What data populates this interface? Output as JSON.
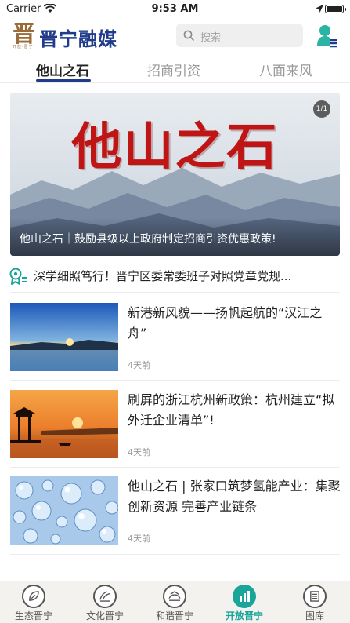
{
  "status_bar": {
    "carrier": "Carrier",
    "time": "9:53 AM"
  },
  "header": {
    "logo_glyph": "晋",
    "logo_sub": "开放·晋宁",
    "app_title": "晋宁融媒",
    "search_placeholder": "搜索"
  },
  "tabs": [
    {
      "label": "他山之石",
      "active": true
    },
    {
      "label": "招商引资",
      "active": false
    },
    {
      "label": "八面来风",
      "active": false
    }
  ],
  "banner": {
    "headline": "他山之石",
    "caption": "他山之石｜鼓励县级以上政府制定招商引资优惠政策!",
    "pager": "1/1"
  },
  "notice": {
    "text": "深学细照笃行！晋宁区委常委班子对照党章党规..."
  },
  "articles": [
    {
      "title": "新港新风貌——扬帆起航的“汉江之舟”",
      "time": "4天前",
      "image": "harbor-sunrise"
    },
    {
      "title": "刷屏的浙江杭州新政策：杭州建立“拟外迁企业清单”!",
      "time": "4天前",
      "image": "lake-pavilion-sunset"
    },
    {
      "title": "他山之石 | 张家口筑梦氢能产业：集聚创新资源 完善产业链条",
      "time": "4天前",
      "image": "hydrogen-bubbles"
    }
  ],
  "bottom_nav": [
    {
      "label": "生态晋宁",
      "icon": "leaf-icon",
      "active": false
    },
    {
      "label": "文化晋宁",
      "icon": "culture-icon",
      "active": false
    },
    {
      "label": "和谐晋宁",
      "icon": "harmony-icon",
      "active": false
    },
    {
      "label": "开放晋宁",
      "icon": "chart-icon",
      "active": true
    },
    {
      "label": "图库",
      "icon": "gallery-icon",
      "active": false
    }
  ],
  "colors": {
    "brand_blue": "#1f3b8a",
    "accent_teal": "#1aa59a",
    "headline_red": "#c01515"
  }
}
